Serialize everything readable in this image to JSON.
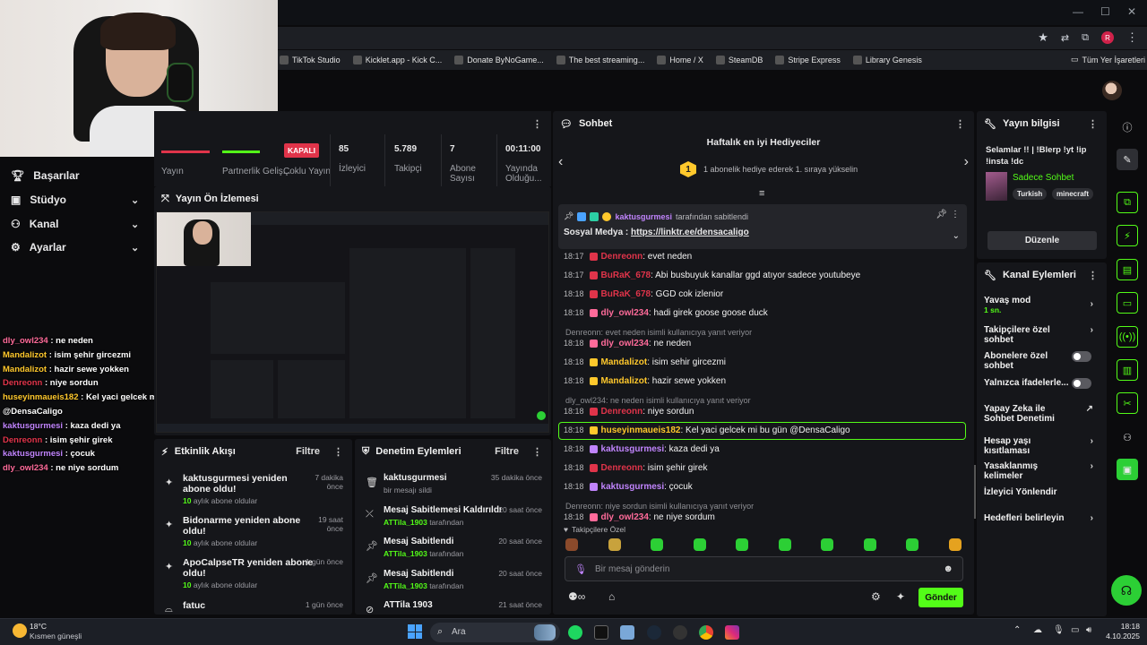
{
  "browser": {
    "bookmarks": [
      {
        "label": "TikTok Studio",
        "icon": "tiktok-icon"
      },
      {
        "label": "Kicklet.app - Kick C...",
        "icon": "kicklet-icon"
      },
      {
        "label": "Donate ByNoGame...",
        "icon": "bynogame-icon"
      },
      {
        "label": "The best streaming...",
        "icon": "streaming-icon"
      },
      {
        "label": "Home / X",
        "icon": "x-icon"
      },
      {
        "label": "SteamDB",
        "icon": "steamdb-icon"
      },
      {
        "label": "Stripe Express",
        "icon": "stripe-icon"
      },
      {
        "label": "Library Genesis",
        "icon": "libgen-icon"
      }
    ],
    "all_bookmarks": "Tüm Yer İşaretleri",
    "profile_letter": "R"
  },
  "nav": {
    "items": [
      {
        "label": "Başarılar"
      },
      {
        "label": "Stüdyo"
      },
      {
        "label": "Kanal"
      },
      {
        "label": "Ayarlar"
      }
    ]
  },
  "overlay_chat": [
    {
      "user": "dly_owl234",
      "text": " : ne neden",
      "color": "#ff6b9a"
    },
    {
      "user": "Mandalizot",
      "text": " : isim şehir gircezmi",
      "color": "#ffc82c"
    },
    {
      "user": "Mandalizot",
      "text": " : hazir sewe yokken",
      "color": "#ffc82c"
    },
    {
      "user": "Denreonn",
      "text": " : niye sordun",
      "color": "#e0344a"
    },
    {
      "user": "huseyinmaueis182",
      "text": " : Kel yaci gelcek mi bu gün",
      "color": "#ffc82c"
    },
    {
      "user": "",
      "text": "@DensaCaligo",
      "color": "#fff"
    },
    {
      "user": "kaktusgurmesi",
      "text": " : kaza dedi ya",
      "color": "#c084fc"
    },
    {
      "user": "Denreonn",
      "text": " : isim şehir girek",
      "color": "#e0344a"
    },
    {
      "user": "kaktusgurmesi",
      "text": " : çocuk",
      "color": "#c084fc"
    },
    {
      "user": "dly_owl234",
      "text": " : ne niye sordum",
      "color": "#ff6b9a"
    }
  ],
  "stats": {
    "live_badge": "KAPALI",
    "items": [
      {
        "label": "Yayın",
        "value": ""
      },
      {
        "label": "Partnerlik Geliş...",
        "value": ""
      },
      {
        "label": "Çoklu Yayın",
        "value": ""
      },
      {
        "label": "İzleyici",
        "value": "85"
      },
      {
        "label": "Takipçi",
        "value": "5.789"
      },
      {
        "label": "Abone Sayısı",
        "value": "7"
      },
      {
        "label": "Yayında Olduğu...",
        "value": "00:11:00"
      }
    ]
  },
  "preview": {
    "title": "Yayın Ön İzlemesi"
  },
  "activity": {
    "title": "Etkinlik Akışı",
    "filter": "Filtre",
    "items": [
      {
        "title": "kaktusgurmesi yeniden abone oldu!",
        "sub_count": "10",
        "sub": " aylık abone oldular",
        "time": "7 dakika önce"
      },
      {
        "title": "Bidonarme yeniden abone oldu!",
        "sub_count": "10",
        "sub": " aylık abone oldular",
        "time": "19 saat önce"
      },
      {
        "title": "ApoCalpseTR yeniden abone oldu!",
        "sub_count": "10",
        "sub": " aylık abone oldular",
        "time": "1 gün önce"
      },
      {
        "title": "fatuc",
        "sub_count": "",
        "sub": "",
        "time": "1 gün önce"
      }
    ]
  },
  "moderation": {
    "title": "Denetim Eylemleri",
    "filter": "Filtre",
    "items": [
      {
        "title": "kaktusgurmesi",
        "sub": "bir mesajı sildi",
        "mod": "",
        "time": "35 dakika önce",
        "icon": "trash-icon"
      },
      {
        "title": "Mesaj Sabitlemesi Kaldırıldı",
        "sub": " tarafından",
        "mod": "ATTila_1903",
        "time": "20 saat önce",
        "icon": "unpin-icon"
      },
      {
        "title": "Mesaj Sabitlendi",
        "sub": " tarafından",
        "mod": "ATTila_1903",
        "time": "20 saat önce",
        "icon": "pin-icon"
      },
      {
        "title": "Mesaj Sabitlendi",
        "sub": " tarafından",
        "mod": "ATTila_1903",
        "time": "20 saat önce",
        "icon": "pin-icon"
      },
      {
        "title": "ATTila 1903",
        "sub": "",
        "mod": "",
        "time": "21 saat önce",
        "icon": "ban-icon"
      }
    ]
  },
  "chat": {
    "title": "Sohbet",
    "gifters_title": "Haftalık en iyi Hediyeciler",
    "gifters_rank": "1",
    "gifters_text": "1 abonelik hediye ederek 1. sıraya yükselin",
    "pinned_by_user": "kaktusgurmesi",
    "pinned_by_text": " tarafından sabitlendi",
    "pinned_label": "Sosyal Medya : ",
    "pinned_link": "https://linktr.ee/densacaligo",
    "messages": [
      {
        "ts": "18:17",
        "user": "Denreonn",
        "color": "#e0344a",
        "text": ": evet neden",
        "reply": ""
      },
      {
        "ts": "18:17",
        "user": "BuRaK_678",
        "color": "#e0344a",
        "text": ": Abi busbuyuk kanallar ggd atıyor sadece youtubeye",
        "reply": ""
      },
      {
        "ts": "18:18",
        "user": "BuRaK_678",
        "color": "#e0344a",
        "text": ": GGD cok izlenior",
        "reply": ""
      },
      {
        "ts": "18:18",
        "user": "dly_owl234",
        "color": "#ff6b9a",
        "text": ": hadi girek goose goose duck",
        "reply": ""
      },
      {
        "ts": "18:18",
        "user": "dly_owl234",
        "color": "#ff6b9a",
        "text": ": ne neden",
        "reply": "Denreonn: evet neden isimli kullanıcıya yanıt veriyor"
      },
      {
        "ts": "18:18",
        "user": "Mandalizot",
        "color": "#ffc82c",
        "text": ": isim sehir gircezmi",
        "reply": ""
      },
      {
        "ts": "18:18",
        "user": "Mandalizot",
        "color": "#ffc82c",
        "text": ": hazir sewe yokken",
        "reply": ""
      },
      {
        "ts": "18:18",
        "user": "Denreonn",
        "color": "#e0344a",
        "text": ": niye sordun",
        "reply": "dly_owl234: ne neden isimli kullanıcıya yanıt veriyor"
      },
      {
        "ts": "18:18",
        "user": "huseyinmaueis182",
        "color": "#ffc82c",
        "text": ": Kel yaci gelcek mi bu gün @DensaCaligo",
        "reply": ""
      },
      {
        "ts": "18:18",
        "user": "kaktusgurmesi",
        "color": "#c084fc",
        "text": ": kaza dedi ya",
        "reply": ""
      },
      {
        "ts": "18:18",
        "user": "Denreonn",
        "color": "#e0344a",
        "text": ": isim şehir girek",
        "reply": ""
      },
      {
        "ts": "18:18",
        "user": "kaktusgurmesi",
        "color": "#c084fc",
        "text": ": çocuk",
        "reply": ""
      },
      {
        "ts": "18:18",
        "user": "dly_owl234",
        "color": "#ff6b9a",
        "text": ": ne niye sordum",
        "reply": "Denreonn: niye sordun isimli kullanıcıya yanıt veriyor"
      }
    ],
    "followers_only": "Takipçilere Özel",
    "input_placeholder": "Bir mesaj gönderin",
    "send": "Gönder"
  },
  "stream_info": {
    "title": "Yayın bilgisi",
    "stream_title": "Selamlar !! | !Blerp !yt !ip !insta !dc",
    "category": "Sadece Sohbet",
    "tags": [
      "Turkish",
      "minecraft"
    ],
    "edit": "Düzenle"
  },
  "channel_actions": {
    "title": "Kanal Eylemleri",
    "slow_mode": "Yavaş mod",
    "slow_mode_value": "1 sn.",
    "items": [
      {
        "label": "Takipçilere özel sohbet",
        "control": "arrow"
      },
      {
        "label": "Abonelere özel sohbet",
        "control": "toggle"
      },
      {
        "label": "Yalnızca ifadelerle...",
        "control": "toggle"
      },
      {
        "label": "Yapay Zeka ile Sohbet Denetimi",
        "control": "external"
      },
      {
        "label": "Hesap yaşı kısıtlaması",
        "control": "arrow"
      },
      {
        "label": "Yasaklanmış kelimeler",
        "control": "arrow"
      },
      {
        "label": "İzleyici Yönlendir",
        "control": "none"
      },
      {
        "label": "Hedefleri belirleyin",
        "control": "arrow"
      }
    ]
  },
  "taskbar": {
    "temp": "18°C",
    "weather": "Kısmen güneşli",
    "search": "Ara",
    "time": "18:18",
    "date": "4.10.2025"
  },
  "colors": {
    "accent": "#53fc18",
    "live": "#e0344a",
    "panel": "#15161a"
  }
}
